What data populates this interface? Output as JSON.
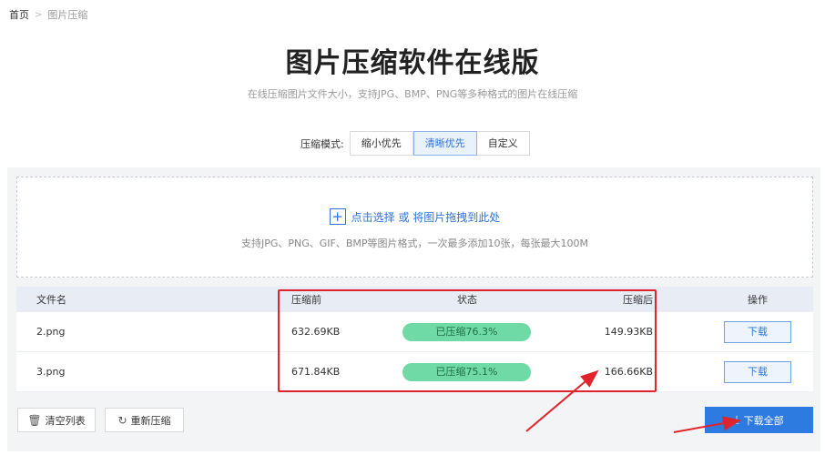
{
  "breadcrumb": {
    "home": "首页",
    "separator": ">",
    "current": "图片压缩"
  },
  "title": "图片压缩软件在线版",
  "subtitle": "在线压缩图片文件大小，支持JPG、BMP、PNG等多种格式的图片在线压缩",
  "mode": {
    "label": "压缩模式:",
    "options": [
      "缩小优先",
      "清晰优先",
      "自定义"
    ],
    "selected": "清晰优先"
  },
  "upload": {
    "action_text": "点击选择 或 将图片拖拽到此处",
    "hint": "支持JPG、PNG、GIF、BMP等图片格式，一次最多添加10张，每张最大100M"
  },
  "table": {
    "headers": {
      "name": "文件名",
      "before": "压缩前",
      "status": "状态",
      "after": "压缩后",
      "op": "操作"
    },
    "rows": [
      {
        "name": "2.png",
        "before": "632.69KB",
        "status": "已压缩76.3%",
        "after": "149.93KB",
        "op": "下载"
      },
      {
        "name": "3.png",
        "before": "671.84KB",
        "status": "已压缩75.1%",
        "after": "166.66KB",
        "op": "下载"
      }
    ]
  },
  "actions": {
    "clear": "清空列表",
    "recompress": "重新压缩",
    "download_all": "下载全部"
  },
  "icons": {
    "upload": "plus-icon",
    "clear": "trash-icon",
    "recompress": "refresh-icon",
    "download_all": "download-icon"
  },
  "colors": {
    "accent": "#2d7ae0",
    "status_pill": "#6fdaa6",
    "annotation": "#e0242c"
  }
}
